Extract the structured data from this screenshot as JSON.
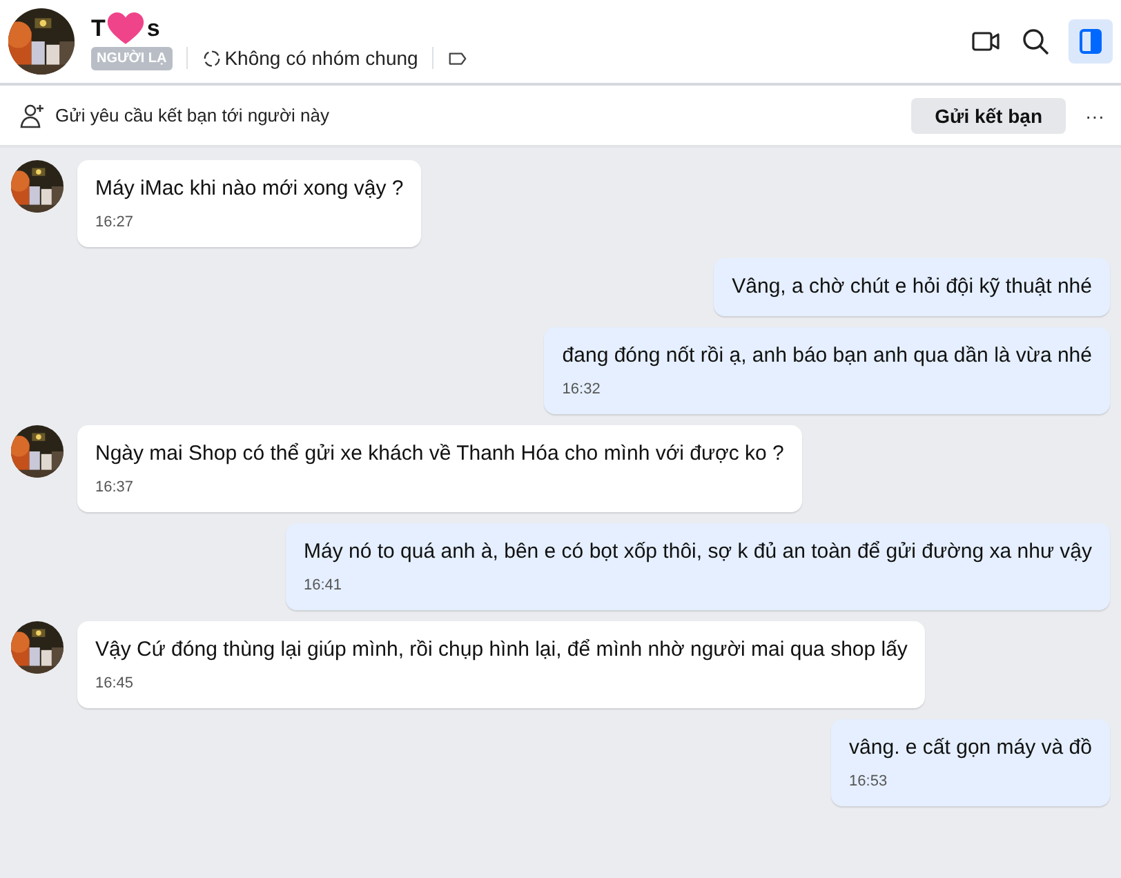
{
  "header": {
    "name_start": "T",
    "name_end": "s",
    "badge": "NGƯỜI LẠ",
    "groups": "Không có nhóm chung"
  },
  "friend_bar": {
    "text": "Gửi yêu cầu kết bạn tới người này",
    "button": "Gửi kết bạn",
    "more": "···"
  },
  "messages": [
    {
      "kind": "incoming",
      "text": "Máy iMac khi nào mới xong vậy ?",
      "time": "16:27"
    },
    {
      "kind": "outgoing",
      "text": "Vâng, a chờ chút e hỏi đội kỹ thuật nhé"
    },
    {
      "kind": "outgoing",
      "text": "đang đóng nốt rồi ạ, anh báo bạn anh qua dần là vừa nhé",
      "time": "16:32"
    },
    {
      "kind": "incoming",
      "text": "Ngày mai Shop có thể gửi xe khách về Thanh Hóa cho mình với được ko ?",
      "time": "16:37"
    },
    {
      "kind": "outgoing",
      "text": "Máy nó to quá anh à, bên e có bọt xốp thôi, sợ k đủ an toàn để gửi đường xa như vậy",
      "time": "16:41"
    },
    {
      "kind": "incoming",
      "text": "Vậy Cứ đóng thùng lại giúp mình, rồi chụp hình lại, để mình nhờ người mai qua shop lấy",
      "time": "16:45"
    },
    {
      "kind": "outgoing",
      "text": "vâng. e cất gọn máy và đồ",
      "time": "16:53"
    }
  ]
}
